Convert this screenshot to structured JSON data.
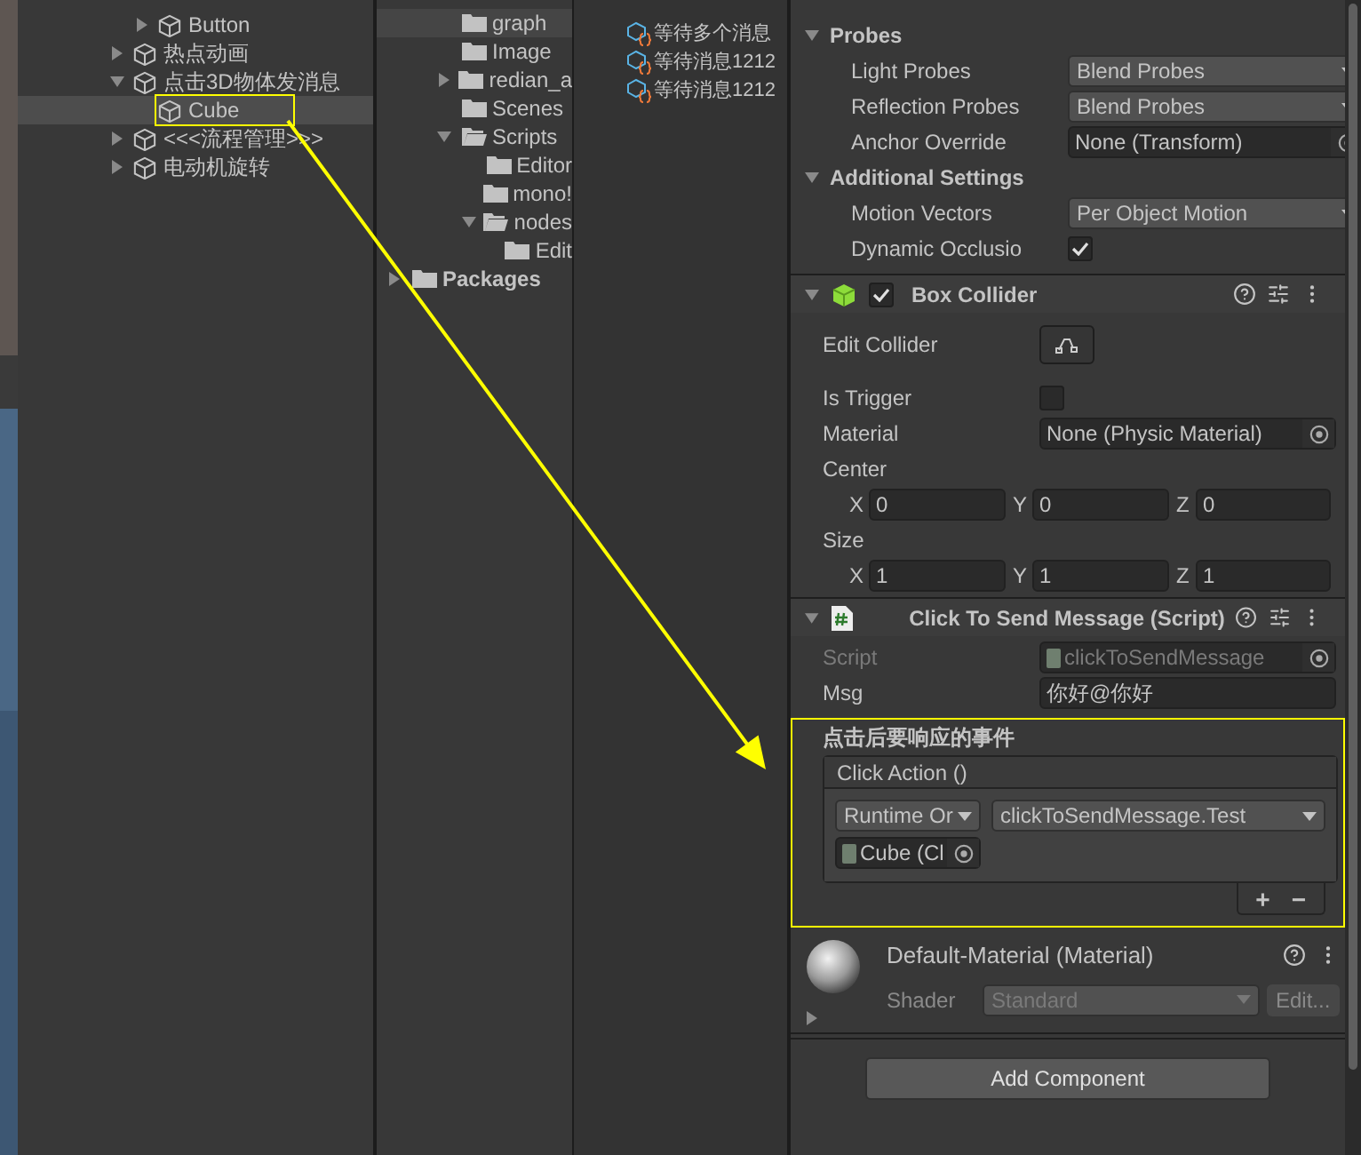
{
  "hierarchy": {
    "items": [
      {
        "children": [
          {
            "label": "Button",
            "expanded": false,
            "selected": false,
            "highlighted": false
          }
        ]
      },
      {
        "label": "热点动画",
        "expanded": false,
        "selected": false,
        "highlighted": false
      },
      {
        "label": "点击3D物体发消息",
        "expanded": true,
        "selected": false,
        "highlighted": false,
        "children": [
          {
            "label": "Cube",
            "selected": true,
            "highlighted": true
          }
        ]
      },
      {
        "label": "<<<流程管理>>>",
        "expanded": false,
        "selected": false,
        "highlighted": false
      },
      {
        "label": "电动机旋转",
        "expanded": false,
        "selected": false,
        "highlighted": false
      }
    ]
  },
  "project": {
    "folders": [
      {
        "children": [
          {
            "children": [
              {
                "label": "graph",
                "selected": true
              },
              {
                "label": "Image",
                "selected": false
              },
              {
                "label": "redian_a",
                "expanded": false,
                "selected": false
              },
              {
                "label": "Scenes",
                "selected": false
              },
              {
                "label": "Scripts",
                "expanded": true,
                "selected": false,
                "children": [
                  {
                    "label": "Editor",
                    "selected": false
                  },
                  {
                    "label": "mono!",
                    "selected": false
                  },
                  {
                    "label": "nodes",
                    "expanded": true,
                    "selected": false,
                    "children": [
                      {
                        "label": "Edit",
                        "selected": false
                      }
                    ]
                  }
                ]
              }
            ]
          }
        ]
      },
      {
        "label": "Packages",
        "expanded": false,
        "selected": false,
        "root": true
      }
    ],
    "files": [
      "等待多个消息",
      "等待消息1212",
      "等待消息1212"
    ]
  },
  "inspector": {
    "renderer_rows": [
      {
        "kind": "foldout",
        "label": "Probes",
        "expanded": true
      },
      {
        "kind": "dropdown",
        "label": "Light Probes",
        "value": "Blend Probes",
        "disabled": false
      },
      {
        "kind": "dropdown",
        "label": "Reflection Probes",
        "value": "Blend Probes",
        "disabled": false
      },
      {
        "kind": "object",
        "label": "Anchor Override",
        "value": "None (Transform)",
        "disabled": false
      },
      {
        "kind": "foldout",
        "label": "Additional Settings",
        "expanded": true
      },
      {
        "kind": "dropdown",
        "label": "Motion Vectors",
        "value": "Per Object Motion",
        "disabled": false
      },
      {
        "kind": "checkbox",
        "label": "Dynamic Occlusio",
        "checked": true,
        "disabled": false
      }
    ],
    "components": [
      {
        "kind": "collider",
        "title": "Box Collider",
        "expanded": true,
        "enabled": true,
        "rows": [
          {
            "kind": "edit",
            "label": "Edit Collider",
            "disabled": false
          },
          {
            "kind": "checkbox",
            "label": "Is Trigger",
            "checked": false,
            "disabled": false
          },
          {
            "kind": "object",
            "label": "Material",
            "value": "None (Physic Material)",
            "disabled": false
          },
          {
            "kind": "vector",
            "label": "Center",
            "axes": [
              {
                "axis": "X",
                "value": "0"
              },
              {
                "axis": "Y",
                "value": "0"
              },
              {
                "axis": "Z",
                "value": "0"
              }
            ]
          },
          {
            "kind": "vector",
            "label": "Size",
            "axes": [
              {
                "axis": "X",
                "value": "1"
              },
              {
                "axis": "Y",
                "value": "1"
              },
              {
                "axis": "Z",
                "value": "1"
              }
            ]
          }
        ]
      },
      {
        "kind": "script",
        "title": "Click To Send Message (Script)",
        "expanded": true,
        "rows": [
          {
            "kind": "object",
            "label": "Script",
            "value": "clickToSendMessage",
            "disabled": true
          },
          {
            "kind": "text",
            "label": "Msg",
            "value": "你好@你好",
            "disabled": false
          },
          {
            "kind": "event",
            "label": "点击后要响应的事件",
            "title": "Click Action ()",
            "highlighted": true,
            "runtime": "Runtime Or",
            "function": "clickToSendMessage.Test",
            "target": "Cube (Cl",
            "add": "+",
            "remove": "−"
          }
        ]
      }
    ],
    "material": {
      "title": "Default-Material (Material)",
      "shader_label": "Shader",
      "shader": "Standard",
      "edit": "Edit..."
    },
    "add_component": "Add Component"
  }
}
